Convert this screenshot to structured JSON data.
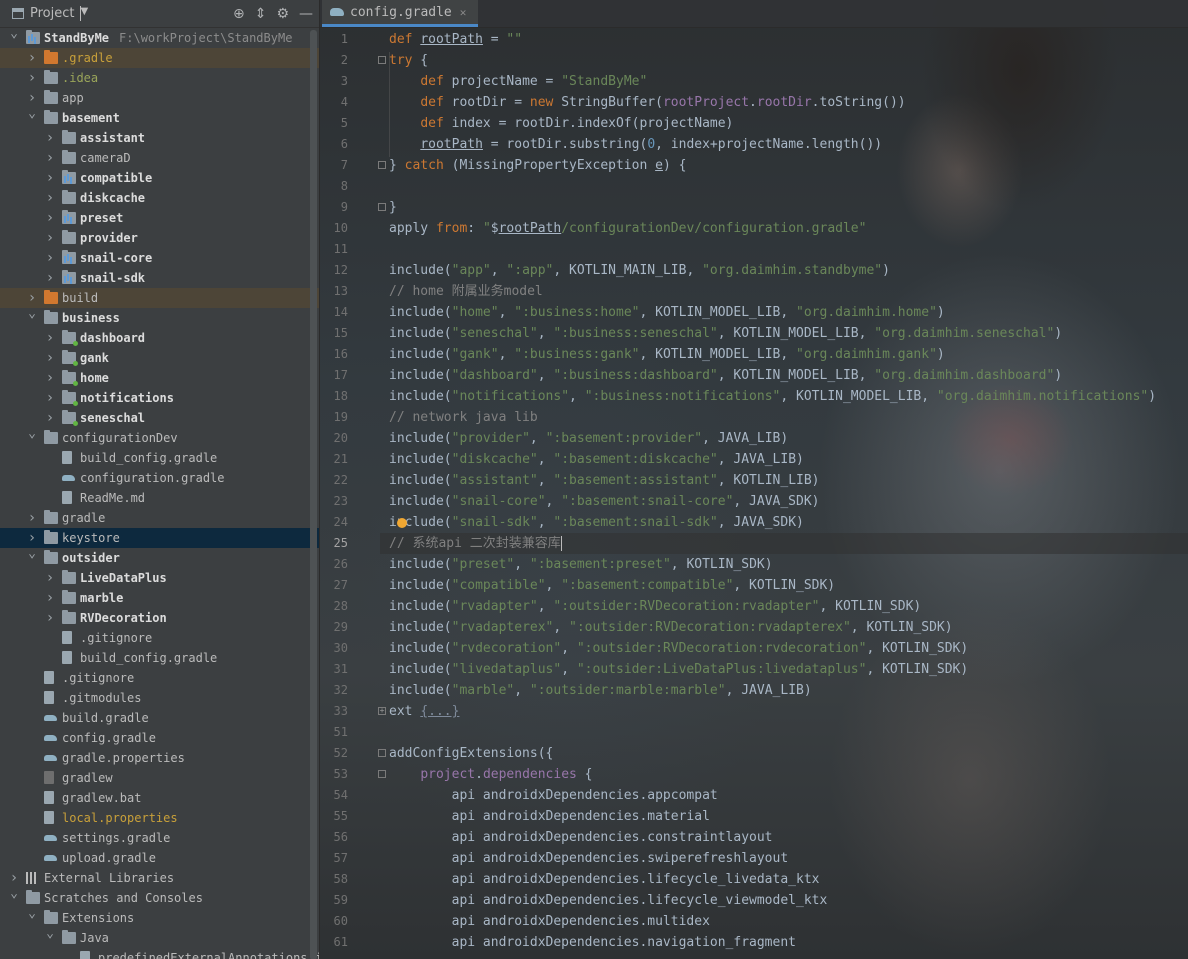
{
  "project_panel": {
    "title": "Project",
    "tree": [
      {
        "label": "StandByMe",
        "sub": "F:\\workProject\\StandByMe",
        "indent": 0,
        "expanded": true,
        "icon": "module-folder",
        "style": "bold"
      },
      {
        "label": ".gradle",
        "indent": 1,
        "expanded": false,
        "icon": "folder-orange",
        "style": "orange",
        "highlight": true
      },
      {
        "label": ".idea",
        "indent": 1,
        "expanded": false,
        "icon": "folder",
        "style": "green"
      },
      {
        "label": "app",
        "indent": 1,
        "expanded": false,
        "icon": "folder",
        "style": "normal"
      },
      {
        "label": "basement",
        "indent": 1,
        "expanded": true,
        "icon": "folder",
        "style": "bold"
      },
      {
        "label": "assistant",
        "indent": 2,
        "expanded": false,
        "icon": "folder",
        "style": "bold"
      },
      {
        "label": "cameraD",
        "indent": 2,
        "expanded": false,
        "icon": "folder",
        "style": "normal"
      },
      {
        "label": "compatible",
        "indent": 2,
        "expanded": false,
        "icon": "module-folder",
        "style": "bold"
      },
      {
        "label": "diskcache",
        "indent": 2,
        "expanded": false,
        "icon": "folder",
        "style": "bold"
      },
      {
        "label": "preset",
        "indent": 2,
        "expanded": false,
        "icon": "module-folder",
        "style": "bold"
      },
      {
        "label": "provider",
        "indent": 2,
        "expanded": false,
        "icon": "folder",
        "style": "bold"
      },
      {
        "label": "snail-core",
        "indent": 2,
        "expanded": false,
        "icon": "module-folder",
        "style": "bold"
      },
      {
        "label": "snail-sdk",
        "indent": 2,
        "expanded": false,
        "icon": "module-folder",
        "style": "bold"
      },
      {
        "label": "build",
        "indent": 1,
        "expanded": false,
        "icon": "folder-orange",
        "style": "normal",
        "highlight": true
      },
      {
        "label": "business",
        "indent": 1,
        "expanded": true,
        "icon": "folder",
        "style": "bold"
      },
      {
        "label": "dashboard",
        "indent": 2,
        "expanded": false,
        "icon": "dot-folder",
        "style": "bold"
      },
      {
        "label": "gank",
        "indent": 2,
        "expanded": false,
        "icon": "dot-folder",
        "style": "bold"
      },
      {
        "label": "home",
        "indent": 2,
        "expanded": false,
        "icon": "dot-folder",
        "style": "bold"
      },
      {
        "label": "notifications",
        "indent": 2,
        "expanded": false,
        "icon": "dot-folder",
        "style": "bold"
      },
      {
        "label": "seneschal",
        "indent": 2,
        "expanded": false,
        "icon": "dot-folder",
        "style": "bold"
      },
      {
        "label": "configurationDev",
        "indent": 1,
        "expanded": true,
        "icon": "folder",
        "style": "normal"
      },
      {
        "label": "build_config.gradle",
        "indent": 2,
        "leaf": true,
        "icon": "file",
        "style": "normal"
      },
      {
        "label": "configuration.gradle",
        "indent": 2,
        "leaf": true,
        "icon": "gradle",
        "style": "normal"
      },
      {
        "label": "ReadMe.md",
        "indent": 2,
        "leaf": true,
        "icon": "file",
        "style": "normal"
      },
      {
        "label": "gradle",
        "indent": 1,
        "expanded": false,
        "icon": "folder",
        "style": "normal"
      },
      {
        "label": "keystore",
        "indent": 1,
        "expanded": false,
        "icon": "folder",
        "style": "normal",
        "selected": true
      },
      {
        "label": "outsider",
        "indent": 1,
        "expanded": true,
        "icon": "folder",
        "style": "bold"
      },
      {
        "label": "LiveDataPlus",
        "indent": 2,
        "expanded": false,
        "icon": "folder",
        "style": "bold"
      },
      {
        "label": "marble",
        "indent": 2,
        "expanded": false,
        "icon": "folder",
        "style": "bold"
      },
      {
        "label": "RVDecoration",
        "indent": 2,
        "expanded": false,
        "icon": "folder",
        "style": "bold"
      },
      {
        "label": ".gitignore",
        "indent": 2,
        "leaf": true,
        "icon": "file",
        "style": "normal"
      },
      {
        "label": "build_config.gradle",
        "indent": 2,
        "leaf": true,
        "icon": "file",
        "style": "normal"
      },
      {
        "label": ".gitignore",
        "indent": 1,
        "leaf": true,
        "icon": "file",
        "style": "normal"
      },
      {
        "label": ".gitmodules",
        "indent": 1,
        "leaf": true,
        "icon": "file",
        "style": "normal"
      },
      {
        "label": "build.gradle",
        "indent": 1,
        "leaf": true,
        "icon": "gradle",
        "style": "normal"
      },
      {
        "label": "config.gradle",
        "indent": 1,
        "leaf": true,
        "icon": "gradle",
        "style": "normal"
      },
      {
        "label": "gradle.properties",
        "indent": 1,
        "leaf": true,
        "icon": "gradle",
        "style": "normal"
      },
      {
        "label": "gradlew",
        "indent": 1,
        "leaf": true,
        "icon": "terminal",
        "style": "normal"
      },
      {
        "label": "gradlew.bat",
        "indent": 1,
        "leaf": true,
        "icon": "file",
        "style": "normal"
      },
      {
        "label": "local.properties",
        "indent": 1,
        "leaf": true,
        "icon": "file",
        "style": "orange"
      },
      {
        "label": "settings.gradle",
        "indent": 1,
        "leaf": true,
        "icon": "gradle",
        "style": "normal"
      },
      {
        "label": "upload.gradle",
        "indent": 1,
        "leaf": true,
        "icon": "gradle",
        "style": "normal"
      },
      {
        "label": "External Libraries",
        "indent": 0,
        "expanded": false,
        "icon": "library",
        "style": "normal"
      },
      {
        "label": "Scratches and Consoles",
        "indent": 0,
        "expanded": true,
        "icon": "folder",
        "style": "normal"
      },
      {
        "label": "Extensions",
        "indent": 1,
        "expanded": true,
        "icon": "folder",
        "style": "normal"
      },
      {
        "label": "Java",
        "indent": 2,
        "expanded": true,
        "icon": "folder",
        "style": "normal"
      },
      {
        "label": "predefinedExternalAnnotations.js",
        "indent": 3,
        "leaf": true,
        "icon": "file",
        "style": "normal"
      }
    ]
  },
  "editor": {
    "tab_label": "config.gradle",
    "current_line": 25,
    "lines": [
      {
        "n": "1",
        "html": "<span class='kw'>def</span> <span class='ul'>rootPath</span> = <span class='str'>\"\"</span>"
      },
      {
        "n": "2",
        "fold": "open",
        "html": "<span class='kw'>try</span> {"
      },
      {
        "n": "3",
        "html": "    <span class='kw'>def</span> projectName = <span class='str'>\"StandByMe\"</span>"
      },
      {
        "n": "4",
        "html": "    <span class='kw'>def</span> rootDir = <span class='kw'>new</span> StringBuffer(<span class='prop'>rootProject</span>.<span class='prop'>rootDir</span>.toString())"
      },
      {
        "n": "5",
        "html": "    <span class='kw'>def</span> index = rootDir.indexOf(projectName)"
      },
      {
        "n": "6",
        "html": "    <span class='ul'>rootPath</span> = rootDir.substring(<span class='num'>0</span>, index+projectName.length())"
      },
      {
        "n": "7",
        "fold": "close",
        "html": "} <span class='kw'>catch</span> (MissingPropertyException <span class='ul'>e</span>) {"
      },
      {
        "n": "8",
        "html": ""
      },
      {
        "n": "9",
        "fold": "close",
        "html": "}"
      },
      {
        "n": "10",
        "html": "apply <span class='kw'>from</span>: <span class='str'>\"</span>$<span class='ul'>rootPath</span><span class='str'>/configurationDev/configuration.gradle\"</span>"
      },
      {
        "n": "11",
        "html": ""
      },
      {
        "n": "12",
        "html": "include(<span class='str'>\"app\"</span>, <span class='str'>\":app\"</span>, KOTLIN_MAIN_LIB, <span class='str'>\"org.daimhim.standbyme\"</span>)"
      },
      {
        "n": "13",
        "html": "<span class='cmt'>// home 附属业务model</span>"
      },
      {
        "n": "14",
        "html": "include(<span class='str'>\"home\"</span>, <span class='str'>\":business:home\"</span>, KOTLIN_MODEL_LIB, <span class='str'>\"org.daimhim.home\"</span>)"
      },
      {
        "n": "15",
        "html": "include(<span class='str'>\"seneschal\"</span>, <span class='str'>\":business:seneschal\"</span>, KOTLIN_MODEL_LIB, <span class='str'>\"org.daimhim.seneschal\"</span>)"
      },
      {
        "n": "16",
        "html": "include(<span class='str'>\"gank\"</span>, <span class='str'>\":business:gank\"</span>, KOTLIN_MODEL_LIB, <span class='str'>\"org.daimhim.gank\"</span>)"
      },
      {
        "n": "17",
        "html": "include(<span class='str'>\"dashboard\"</span>, <span class='str'>\":business:dashboard\"</span>, KOTLIN_MODEL_LIB, <span class='str'>\"org.daimhim.dashboard\"</span>)"
      },
      {
        "n": "18",
        "html": "include(<span class='str'>\"notifications\"</span>, <span class='str'>\":business:notifications\"</span>, KOTLIN_MODEL_LIB, <span class='str'>\"org.daimhim.notifications\"</span>)"
      },
      {
        "n": "19",
        "html": "<span class='cmt'>// network java lib</span>"
      },
      {
        "n": "20",
        "html": "include(<span class='str'>\"provider\"</span>, <span class='str'>\":basement:provider\"</span>, JAVA_LIB)"
      },
      {
        "n": "21",
        "html": "include(<span class='str'>\"diskcache\"</span>, <span class='str'>\":basement:diskcache\"</span>, JAVA_LIB)"
      },
      {
        "n": "22",
        "html": "include(<span class='str'>\"assistant\"</span>, <span class='str'>\":basement:assistant\"</span>, KOTLIN_LIB)"
      },
      {
        "n": "23",
        "html": "include(<span class='str'>\"snail-core\"</span>, <span class='str'>\":basement:snail-core\"</span>, JAVA_SDK)"
      },
      {
        "n": "24",
        "bulb": true,
        "html": "include(<span class='str'>\"snail-sdk\"</span>, <span class='str'>\":basement:snail-sdk\"</span>, JAVA_SDK)"
      },
      {
        "n": "25",
        "caret": true,
        "html": "<span class='cmt'>// 系统api 二次封装兼容库</span>"
      },
      {
        "n": "26",
        "html": "include(<span class='str'>\"preset\"</span>, <span class='str'>\":basement:preset\"</span>, KOTLIN_SDK)"
      },
      {
        "n": "27",
        "html": "include(<span class='str'>\"compatible\"</span>, <span class='str'>\":basement:compatible\"</span>, KOTLIN_SDK)"
      },
      {
        "n": "28",
        "html": "include(<span class='str'>\"rvadapter\"</span>, <span class='str'>\":outsider:RVDecoration:rvadapter\"</span>, KOTLIN_SDK)"
      },
      {
        "n": "29",
        "html": "include(<span class='str'>\"rvadapterex\"</span>, <span class='str'>\":outsider:RVDecoration:rvadapterex\"</span>, KOTLIN_SDK)"
      },
      {
        "n": "30",
        "html": "include(<span class='str'>\"rvdecoration\"</span>, <span class='str'>\":outsider:RVDecoration:rvdecoration\"</span>, KOTLIN_SDK)"
      },
      {
        "n": "31",
        "html": "include(<span class='str'>\"livedataplus\"</span>, <span class='str'>\":outsider:LiveDataPlus:livedataplus\"</span>, KOTLIN_SDK)"
      },
      {
        "n": "32",
        "html": "include(<span class='str'>\"marble\"</span>, <span class='str'>\":outsider:marble:marble\"</span>, JAVA_LIB)"
      },
      {
        "n": "33",
        "fold": "collapsed",
        "html": "ext <span class='foldtxt'>{...}</span>"
      },
      {
        "n": "51",
        "html": ""
      },
      {
        "n": "52",
        "fold": "open",
        "html": "addConfigExtensions({"
      },
      {
        "n": "53",
        "fold": "open",
        "html": "    <span class='prop'>project</span>.<span class='prop'>dependencies</span> {"
      },
      {
        "n": "54",
        "html": "        api androidxDependencies.appcompat"
      },
      {
        "n": "55",
        "html": "        api androidxDependencies.material"
      },
      {
        "n": "56",
        "html": "        api androidxDependencies.constraintlayout"
      },
      {
        "n": "57",
        "html": "        api androidxDependencies.swiperefreshlayout"
      },
      {
        "n": "58",
        "html": "        api androidxDependencies.lifecycle_livedata_ktx"
      },
      {
        "n": "59",
        "html": "        api androidxDependencies.lifecycle_viewmodel_ktx"
      },
      {
        "n": "60",
        "html": "        api androidxDependencies.multidex"
      },
      {
        "n": "61",
        "html": "        api androidxDependencies.navigation_fragment"
      }
    ]
  }
}
